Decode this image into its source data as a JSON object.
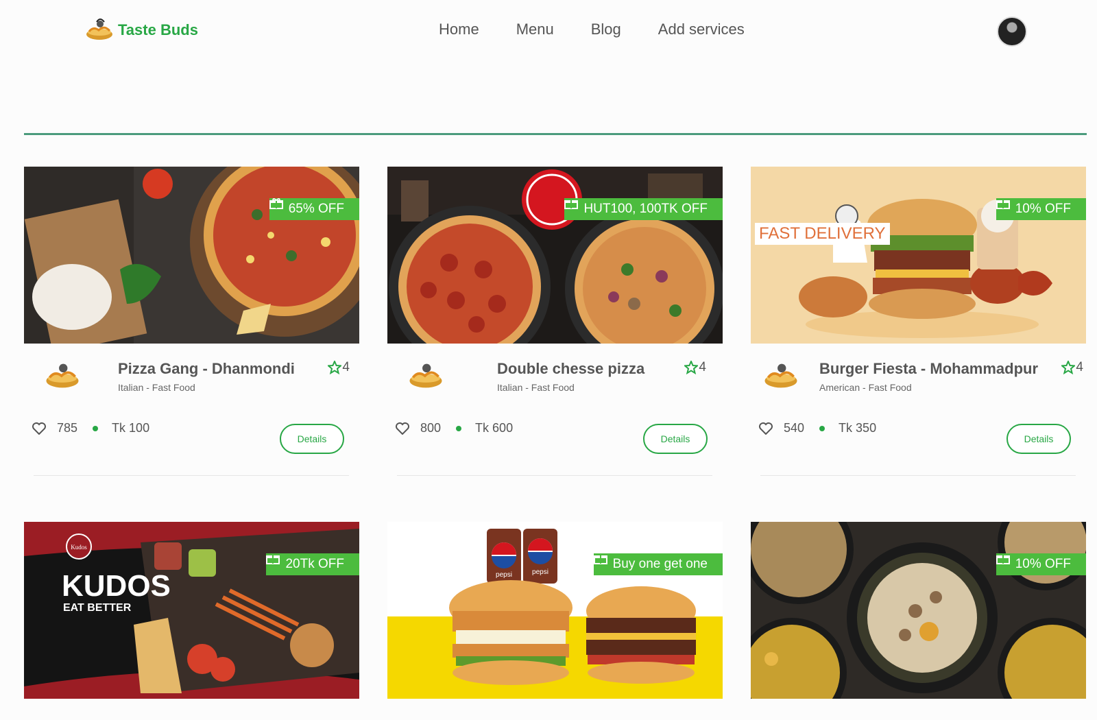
{
  "brand": {
    "name": "Taste Buds"
  },
  "nav": [
    {
      "label": "Home"
    },
    {
      "label": "Menu"
    },
    {
      "label": "Blog"
    },
    {
      "label": "Add services"
    }
  ],
  "details_label": "Details",
  "cards": [
    {
      "offer": "65% OFF",
      "title": "Pizza Gang - Dhanmondi",
      "subtitle": "Italian - Fast Food",
      "rating": "4",
      "likes": "785",
      "price": "Tk 100",
      "image": "pizza-board"
    },
    {
      "offer": "HUT100, 100TK OFF",
      "title": "Double chesse pizza",
      "subtitle": "Italian - Fast Food",
      "rating": "4",
      "likes": "800",
      "price": "Tk 600",
      "image": "pizza-hut"
    },
    {
      "offer": "10% OFF",
      "badge_text": "FAST DELIVERY",
      "title": "Burger Fiesta - Mohammadpur",
      "subtitle": "American - Fast Food",
      "rating": "4",
      "likes": "540",
      "price": "Tk 350",
      "image": "burger-combo"
    },
    {
      "offer": "20Tk OFF",
      "title": "",
      "subtitle": "",
      "image": "kudos"
    },
    {
      "offer": "Buy one get one",
      "title": "",
      "subtitle": "",
      "image": "pepsi-burgers"
    },
    {
      "offer": "10% OFF",
      "title": "",
      "subtitle": "",
      "image": "biryani"
    }
  ],
  "image_text": {
    "kudos_brand": "KUDOS",
    "kudos_tag": "EAT BETTER",
    "kudos_small": "Kudos",
    "pepsi": "pepsi"
  },
  "colors": {
    "accent": "#28a745",
    "badge": "#4cbc3e",
    "divider": "#4b9b7c"
  }
}
